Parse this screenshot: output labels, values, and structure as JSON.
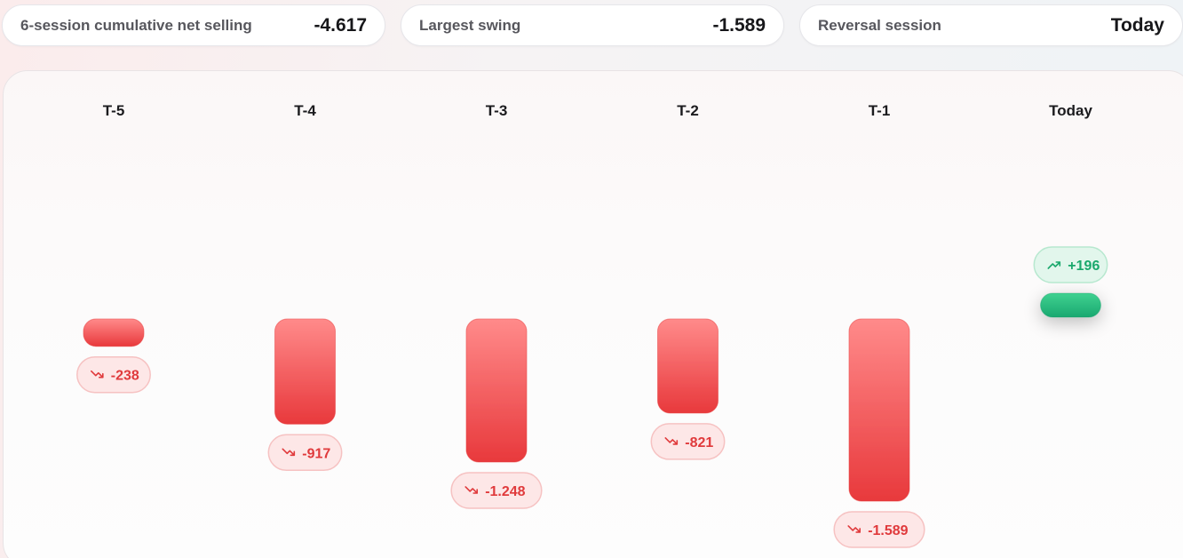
{
  "stats": [
    {
      "label": "6-session cumulative net selling",
      "value": "-4.617"
    },
    {
      "label": "Largest swing",
      "value": "-1.589"
    },
    {
      "label": "Reversal session",
      "value": "Today"
    }
  ],
  "chart_data": {
    "type": "bar",
    "categories": [
      "T-5",
      "T-4",
      "T-3",
      "T-2",
      "T-1",
      "Today"
    ],
    "values": [
      -238,
      -917,
      -1248,
      -821,
      -1589,
      196
    ],
    "data_labels": [
      "-238",
      "-917",
      "-1.248",
      "-821",
      "-1.589",
      "+196"
    ],
    "colors": {
      "negative": "#ef4d4f",
      "negative_light": "#ff8a8a",
      "positive": "#22b97a",
      "positive_light": "#3fd190",
      "negative_text": "#e03a3c",
      "positive_text": "#1aa86c"
    },
    "icons": {
      "negative": "trend-down-icon",
      "positive": "trend-up-icon"
    },
    "grid": false,
    "legend": "none"
  }
}
